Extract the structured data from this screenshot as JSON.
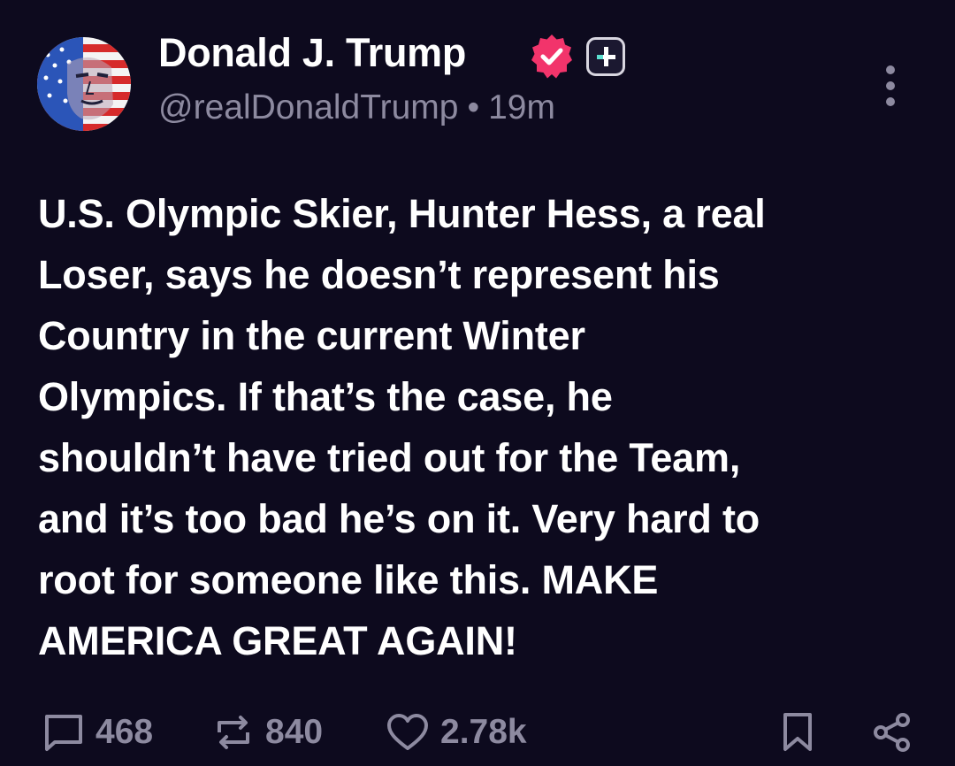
{
  "author": {
    "display_name": "Donald J. Trump",
    "handle": "@realDonaldTrump",
    "separator": "•",
    "timestamp": "19m",
    "verified_color": "#f2346b"
  },
  "post": {
    "text": "U.S. Olympic Skier, Hunter Hess, a real\nLoser, says he doesn’t represent his\nCountry in the current Winter\nOlympics. If that’s the case, he\nshouldn’t have tried out for the Team,\nand it’s too bad he’s on it. Very hard to\nroot for someone like this. MAKE\nAMERICA GREAT AGAIN!"
  },
  "actions": {
    "replies": "468",
    "reposts": "840",
    "likes": "2.78k"
  },
  "colors": {
    "background": "#0d0a1e",
    "text": "#ffffff",
    "muted": "#8d8aa0",
    "accent": "#5ce0d0"
  }
}
